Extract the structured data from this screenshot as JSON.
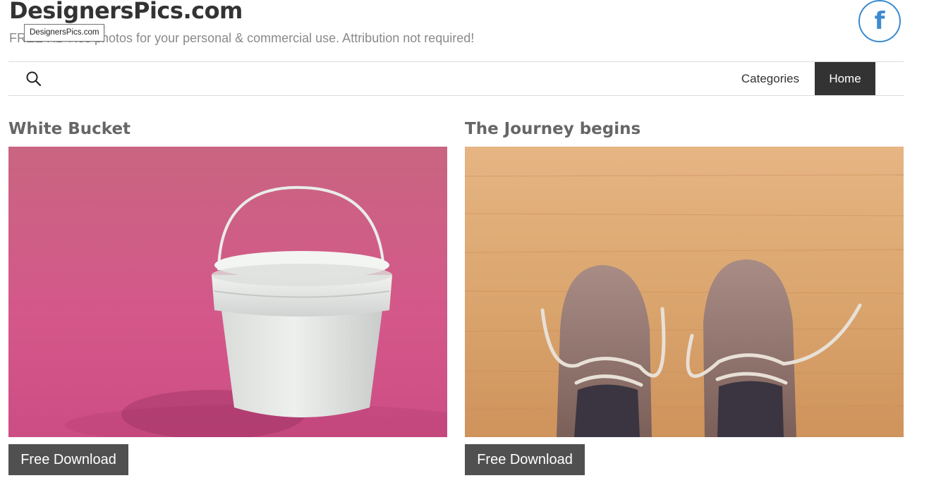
{
  "header": {
    "site_title": "DesignersPics.com",
    "tagline": "FREE HD Res photos for your personal & commercial use. Attribution not required!",
    "tooltip": "DesignersPics.com",
    "facebook_icon": "facebook-icon",
    "facebook_glyph": "f",
    "facebook_color": "#3d8bcf"
  },
  "nav": {
    "search_icon": "search-icon",
    "items": [
      {
        "label": "Categories",
        "active": false
      },
      {
        "label": "Home",
        "active": true
      }
    ]
  },
  "posts": [
    {
      "title": "White Bucket",
      "download_label": "Free Download"
    },
    {
      "title": "The Journey begins",
      "download_label": "Free Download"
    }
  ]
}
